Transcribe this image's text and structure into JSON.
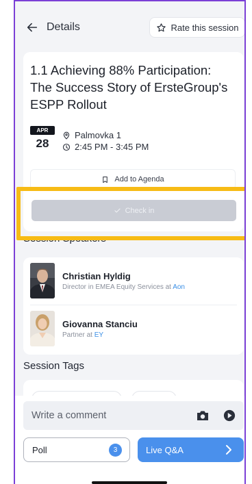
{
  "header": {
    "back_label": "Details",
    "rate_label": "Rate this session"
  },
  "session": {
    "title": "1.1 Achieving 88% Participation: The Success Story of ErsteGroup's ESPP Rollout",
    "date_month": "APR",
    "date_day": "28",
    "location": "Palmovka 1",
    "time": "2:45 PM - 3:45 PM",
    "agenda_label": "Add to Agenda",
    "checkin_label": "Check in"
  },
  "speakers": {
    "heading": "Session Speakers",
    "items": [
      {
        "name": "Christian Hyldig",
        "role_prefix": "Director in EMEA Equity Services at",
        "company": "Aon"
      },
      {
        "name": "Giovanna Stanciu",
        "role_prefix": "Partner at",
        "company": "EY"
      }
    ]
  },
  "tags": {
    "heading": "Session Tags"
  },
  "bottom": {
    "comment_placeholder": "Write a comment",
    "poll_label": "Poll",
    "poll_count": "3",
    "qa_label": "Live Q&A"
  },
  "colors": {
    "accent": "#4a90ec",
    "highlight": "#f7bb15",
    "frame": "#7b3fd6",
    "checkin_disabled": "#c9ccd4"
  },
  "icons": [
    "arrow-left-icon",
    "star-icon",
    "location-pin-icon",
    "clock-icon",
    "bookmark-icon",
    "check-icon",
    "camera-icon",
    "send-icon",
    "chevron-right-icon"
  ]
}
